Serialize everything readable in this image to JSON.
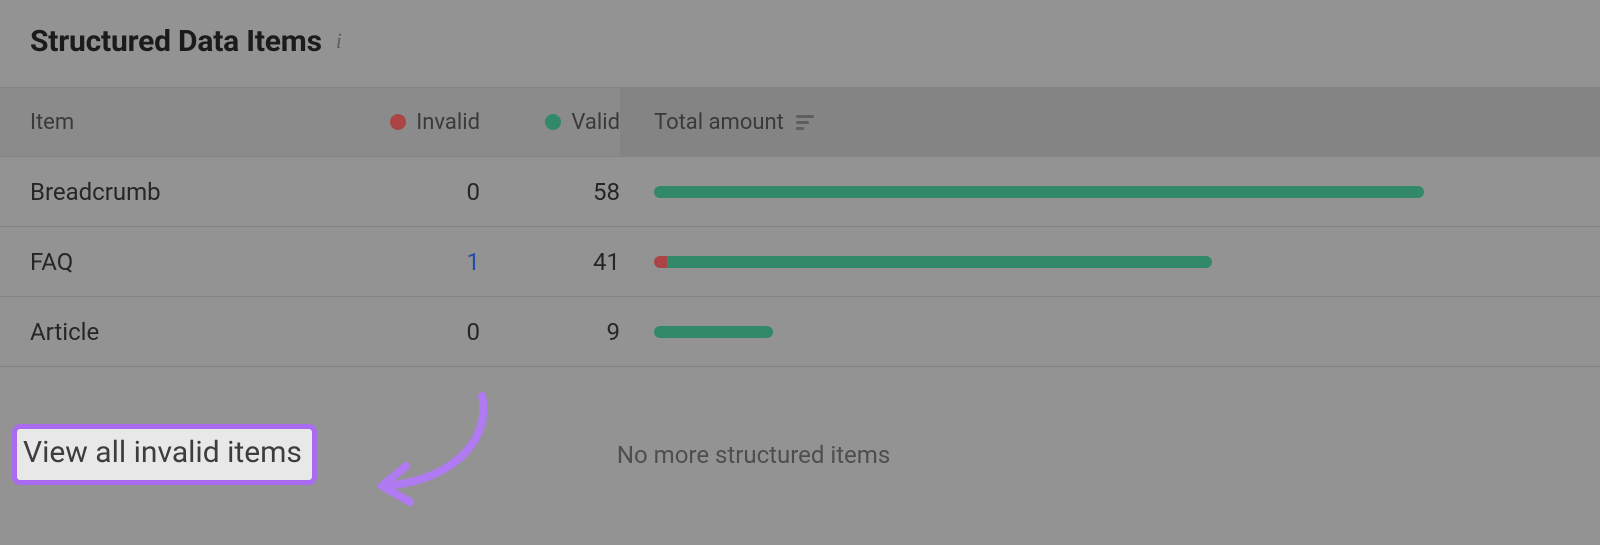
{
  "title": "Structured Data Items",
  "columns": {
    "item": "Item",
    "invalid": "Invalid",
    "valid": "Valid",
    "total": "Total amount"
  },
  "colors": {
    "invalid": "#d04747",
    "valid": "#2fa37a",
    "highlight": "#a96cf0",
    "link": "#1a54c7"
  },
  "rows": [
    {
      "name": "Breadcrumb",
      "invalid": 0,
      "valid": 58,
      "invalid_is_link": false
    },
    {
      "name": "FAQ",
      "invalid": 1,
      "valid": 41,
      "invalid_is_link": true
    },
    {
      "name": "Article",
      "invalid": 0,
      "valid": 9,
      "invalid_is_link": false
    }
  ],
  "empty_message": "No more structured items",
  "view_all_link": "View all invalid items",
  "chart_data": {
    "type": "bar",
    "orientation": "horizontal",
    "stacked": true,
    "categories": [
      "Breadcrumb",
      "FAQ",
      "Article"
    ],
    "series": [
      {
        "name": "Invalid",
        "color": "#d04747",
        "values": [
          0,
          1,
          0
        ]
      },
      {
        "name": "Valid",
        "color": "#2fa37a",
        "values": [
          58,
          41,
          9
        ]
      }
    ],
    "xlabel": "Total amount",
    "xlim": [
      0,
      58
    ]
  }
}
